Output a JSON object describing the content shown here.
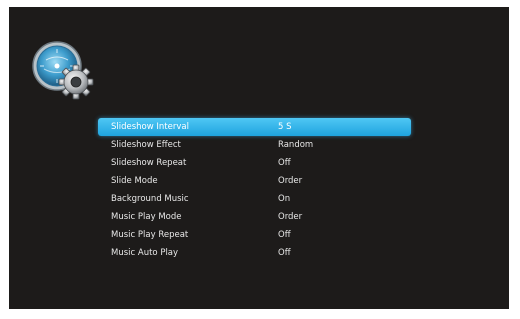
{
  "header": {
    "icon": "settings-gear-icon"
  },
  "menu": {
    "selected_index": 0,
    "highlight_color": "#2eb2e8",
    "items": [
      {
        "label": "Slideshow Interval",
        "value": "5 S"
      },
      {
        "label": "Slideshow Effect",
        "value": "Random"
      },
      {
        "label": "Slideshow Repeat",
        "value": "Off"
      },
      {
        "label": "Slide Mode",
        "value": "Order"
      },
      {
        "label": "Background Music",
        "value": "On"
      },
      {
        "label": "Music Play Mode",
        "value": "Order"
      },
      {
        "label": "Music Play Repeat",
        "value": "Off"
      },
      {
        "label": "Music Auto Play",
        "value": "Off"
      }
    ]
  }
}
